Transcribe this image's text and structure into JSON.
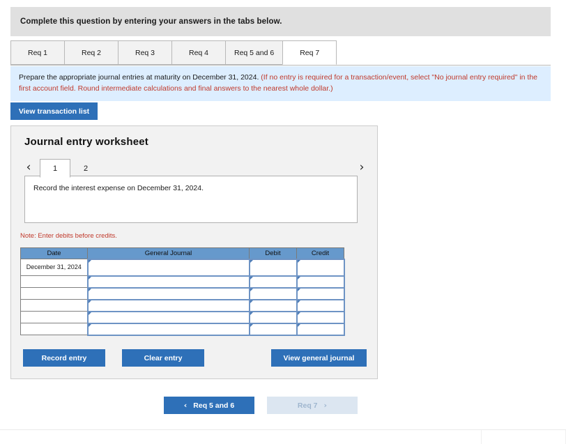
{
  "header": {
    "instruction": "Complete this question by entering your answers in the tabs below."
  },
  "req_tabs": {
    "items": [
      {
        "label": "Req 1",
        "active": false
      },
      {
        "label": "Req 2",
        "active": false
      },
      {
        "label": "Req 3",
        "active": false
      },
      {
        "label": "Req 4",
        "active": false
      },
      {
        "label": "Req 5 and 6",
        "active": false
      },
      {
        "label": "Req 7",
        "active": true
      }
    ]
  },
  "requirement": {
    "text_black": "Prepare the appropriate journal entries at maturity on December 31, 2024. ",
    "text_red": "(If no entry is required for a transaction/event, select \"No journal entry required\" in the first account field. Round intermediate calculations and final answers to the nearest whole dollar.)"
  },
  "toolbar": {
    "view_transaction_list": "View transaction list"
  },
  "worksheet": {
    "title": "Journal entry worksheet",
    "pager": {
      "prev_icon": "‹",
      "next_icon": "›",
      "pages": [
        {
          "label": "1",
          "active": true
        },
        {
          "label": "2",
          "active": false
        }
      ]
    },
    "prompt": "Record the interest expense on December 31, 2024.",
    "note": "Note: Enter debits before credits.",
    "table": {
      "columns": [
        "Date",
        "General Journal",
        "Debit",
        "Credit"
      ],
      "rows": [
        {
          "date": "December 31, 2024",
          "general_journal": "",
          "debit": "",
          "credit": ""
        },
        {
          "date": "",
          "general_journal": "",
          "debit": "",
          "credit": ""
        },
        {
          "date": "",
          "general_journal": "",
          "debit": "",
          "credit": ""
        },
        {
          "date": "",
          "general_journal": "",
          "debit": "",
          "credit": ""
        },
        {
          "date": "",
          "general_journal": "",
          "debit": "",
          "credit": ""
        },
        {
          "date": "",
          "general_journal": "",
          "debit": "",
          "credit": ""
        }
      ]
    },
    "buttons": {
      "record_entry": "Record entry",
      "clear_entry": "Clear entry",
      "view_general_journal": "View general journal"
    }
  },
  "nav": {
    "prev_label": "Req 5 and 6",
    "next_label": "Req 7",
    "prev_icon": "‹",
    "next_icon": "›"
  },
  "colors": {
    "primary_blue": "#2e70b8",
    "table_header_blue": "#6699cc",
    "info_banner": "#ddeeff",
    "note_red": "#c0392b",
    "disabled_button": "#dce6f1"
  }
}
